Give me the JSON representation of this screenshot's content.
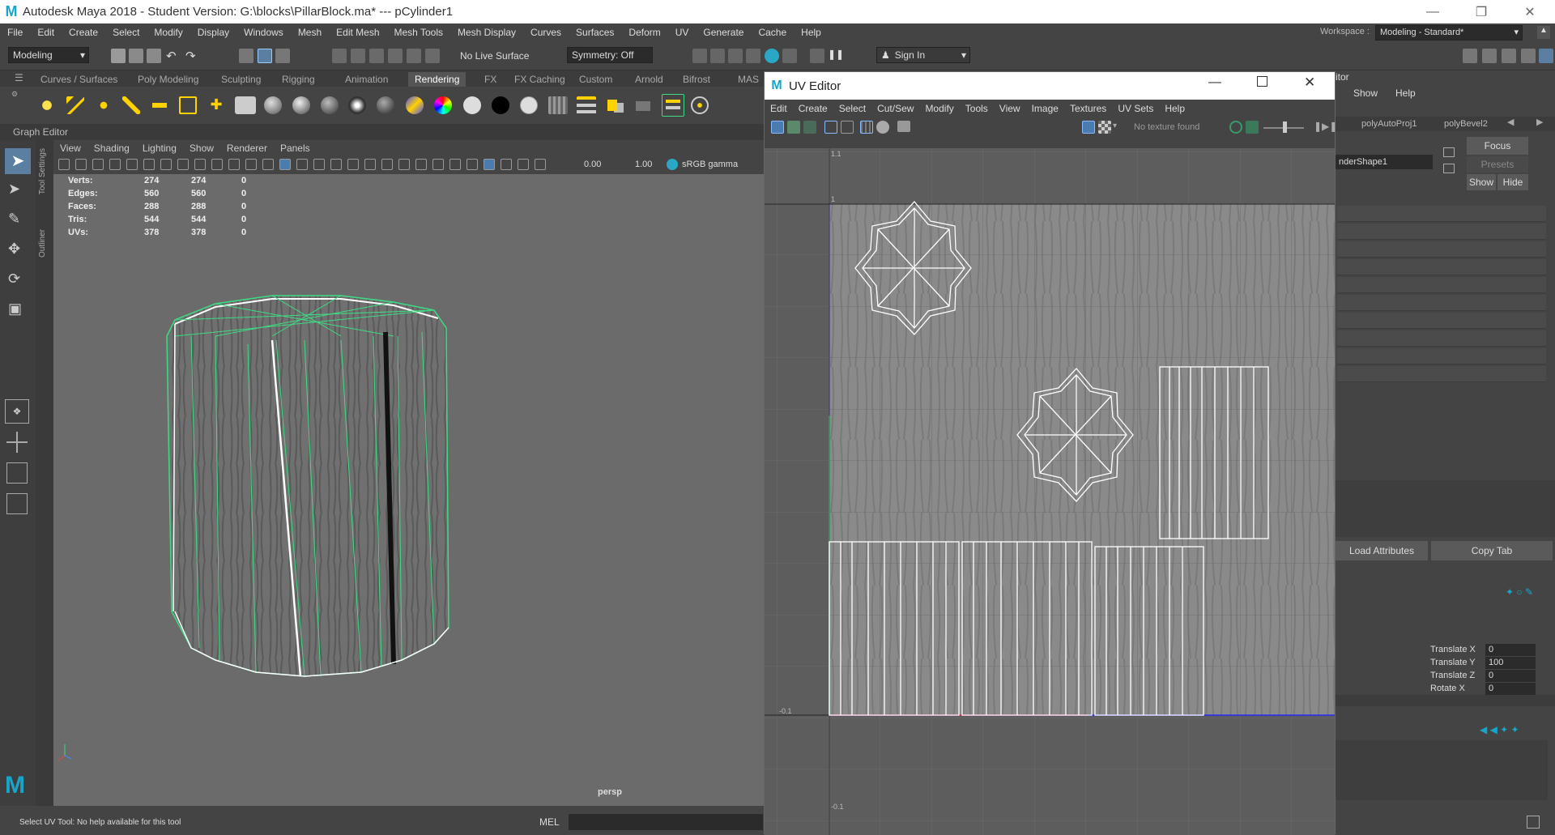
{
  "window": {
    "title": "Autodesk Maya 2018 - Student Version: G:\\blocks\\PillarBlock.ma*   ---   pCylinder1"
  },
  "menu": [
    "File",
    "Edit",
    "Create",
    "Select",
    "Modify",
    "Display",
    "Windows",
    "Mesh",
    "Edit Mesh",
    "Mesh Tools",
    "Mesh Display",
    "Curves",
    "Surfaces",
    "Deform",
    "UV",
    "Generate",
    "Cache",
    "Help"
  ],
  "workspace": {
    "label": "Workspace :",
    "value": "Modeling - Standard*"
  },
  "status": {
    "mode": "Modeling",
    "live_surface": "No Live Surface",
    "symmetry": "Symmetry: Off",
    "signin": "Sign In"
  },
  "shelf_tabs": [
    "Curves / Surfaces",
    "Poly Modeling",
    "Sculpting",
    "Rigging",
    "Animation",
    "Rendering",
    "FX",
    "FX Caching",
    "Custom",
    "Arnold",
    "Bifrost",
    "MAS"
  ],
  "shelf_active": "Rendering",
  "panel_header": "Graph Editor",
  "side_tabs": [
    "Tool Settings",
    "Outliner"
  ],
  "viewport": {
    "menu": [
      "View",
      "Shading",
      "Lighting",
      "Show",
      "Renderer",
      "Panels"
    ],
    "exposure": "0.00",
    "gamma": "1.00",
    "colorspace": "sRGB gamma",
    "camera": "persp",
    "hud": [
      {
        "label": "Verts:",
        "a": "274",
        "b": "274",
        "c": "0"
      },
      {
        "label": "Edges:",
        "a": "560",
        "b": "560",
        "c": "0"
      },
      {
        "label": "Faces:",
        "a": "288",
        "b": "288",
        "c": "0"
      },
      {
        "label": "Tris:",
        "a": "544",
        "b": "544",
        "c": "0"
      },
      {
        "label": "UVs:",
        "a": "378",
        "b": "378",
        "c": "0"
      }
    ]
  },
  "uv_editor": {
    "title": "UV Editor",
    "menu": [
      "Edit",
      "Create",
      "Select",
      "Cut/Sew",
      "Modify",
      "Tools",
      "View",
      "Image",
      "Textures",
      "UV Sets",
      "Help"
    ],
    "texture_status": "No texture found",
    "axis_labels": {
      "top": "1.1",
      "one": "1",
      "bottom": "-0.1",
      "lower": "-0.1"
    }
  },
  "attribute_editor": {
    "title_partial": "itor",
    "menu": [
      "Show",
      "Help"
    ],
    "tabs": [
      "polyAutoProj1",
      "polyBevel2"
    ],
    "node": "nderShape1",
    "focus": "Focus",
    "presets": "Presets",
    "show": "Show",
    "hide": "Hide",
    "load_attributes": "Load Attributes",
    "copy_tab": "Copy Tab",
    "channels": [
      {
        "label": "Translate X",
        "value": "0"
      },
      {
        "label": "Translate Y",
        "value": "100"
      },
      {
        "label": "Translate Z",
        "value": "0"
      },
      {
        "label": "Rotate X",
        "value": "0"
      }
    ]
  },
  "help_line": "Select UV Tool: No help available for this tool",
  "command_lang": "MEL",
  "colors": {
    "wire": "#3ddc84",
    "accent": "#17a6c9"
  }
}
